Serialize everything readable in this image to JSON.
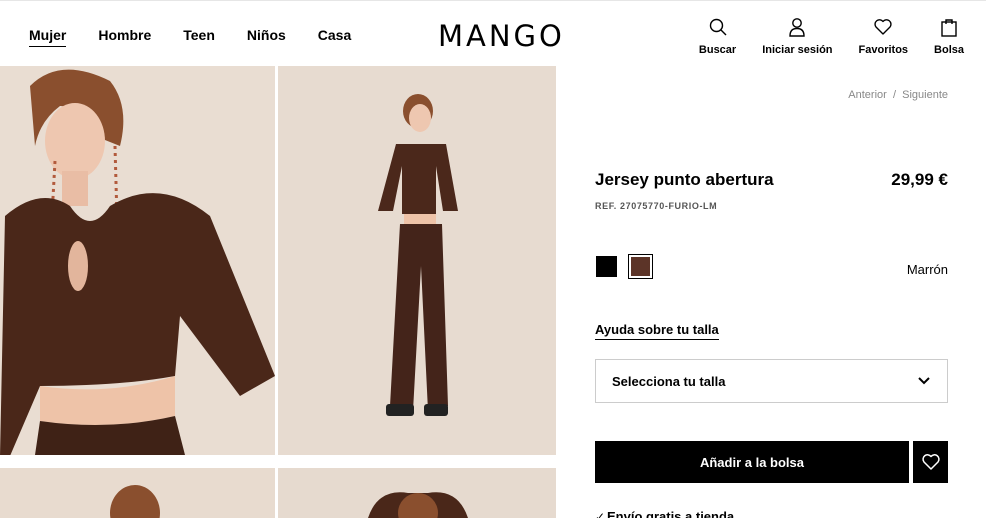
{
  "header": {
    "logo": "MANGO",
    "nav": [
      "Mujer",
      "Hombre",
      "Teen",
      "Niños",
      "Casa"
    ],
    "tools": {
      "search": "Buscar",
      "login": "Iniciar sesión",
      "favorites": "Favoritos",
      "bag": "Bolsa"
    }
  },
  "navigation": {
    "previous": "Anterior",
    "separator": "/",
    "next": "Siguiente"
  },
  "product": {
    "title": "Jersey punto abertura",
    "price": "29,99 €",
    "ref": "REF. 27075770-FURIO-LM",
    "selected_color": "Marrón",
    "colors": [
      {
        "name": "black",
        "hex": "#000000"
      },
      {
        "name": "brown",
        "hex": "#5c3428"
      }
    ],
    "size_help": "Ayuda sobre tu talla",
    "size_placeholder": "Selecciona tu talla",
    "add_button": "Añadir a la bolsa",
    "shipping": "Envío gratis a tienda"
  }
}
